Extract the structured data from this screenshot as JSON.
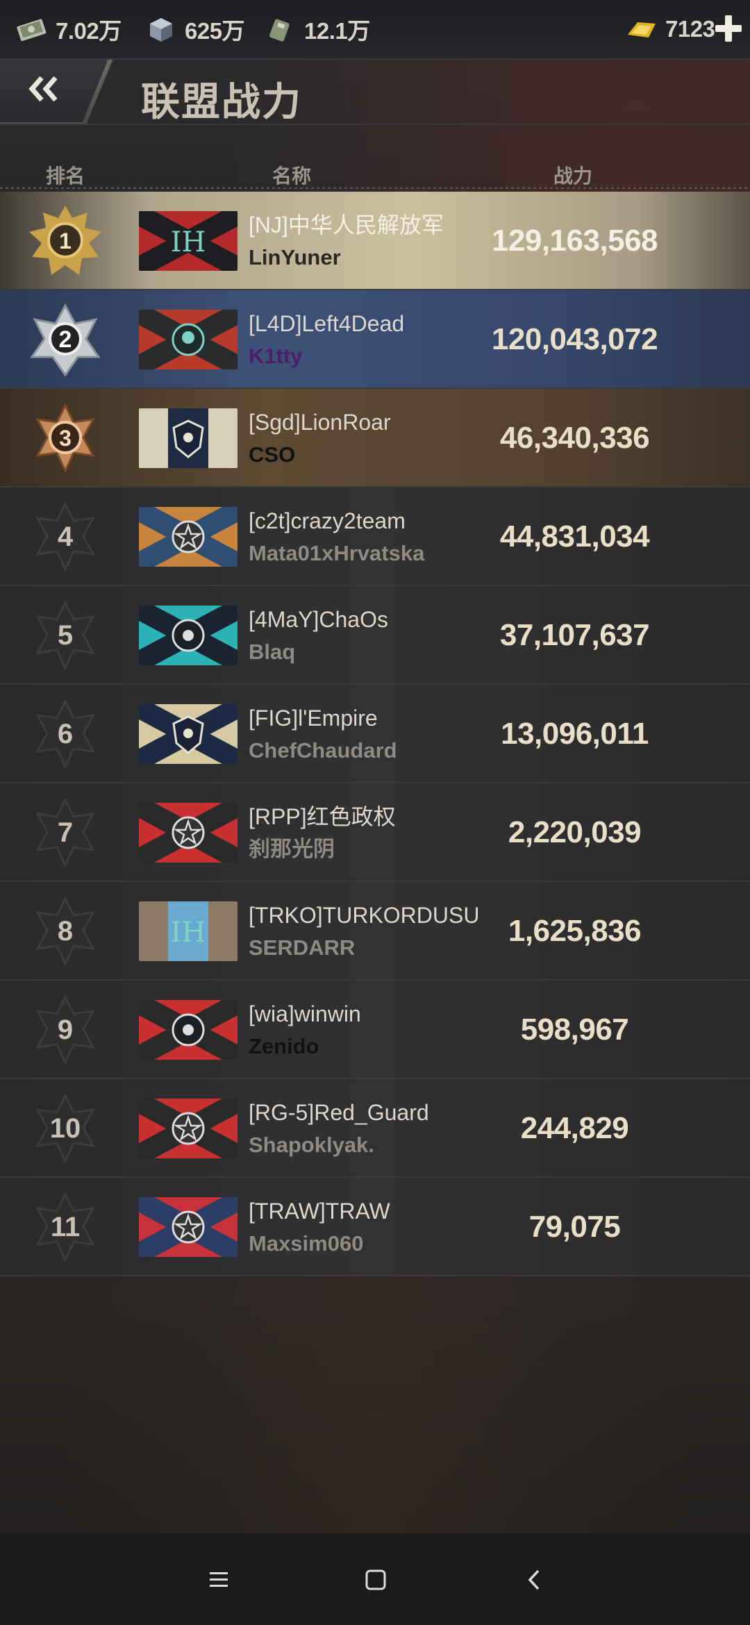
{
  "resources": [
    {
      "icon": "banknote-icon",
      "value": "7.02万"
    },
    {
      "icon": "steel-block-icon",
      "value": "625万"
    },
    {
      "icon": "fuel-can-icon",
      "value": "12.1万"
    }
  ],
  "gold": {
    "icon": "gold-bars-icon",
    "value": "7123"
  },
  "header": {
    "title": "联盟战力",
    "back_icon": "double-chevron-left-icon"
  },
  "columns": {
    "rank": "排名",
    "name": "名称",
    "power": "战力"
  },
  "rows": [
    {
      "rank": "1",
      "clan": "[NJ]中华人民解放军",
      "leader": "LinYuner",
      "power": "129,163,568"
    },
    {
      "rank": "2",
      "clan": "[L4D]Left4Dead",
      "leader": "K1tty",
      "power": "120,043,072"
    },
    {
      "rank": "3",
      "clan": "[Sgd]LionRoar",
      "leader": "CSO",
      "power": "46,340,336"
    },
    {
      "rank": "4",
      "clan": "[c2t]crazy2team",
      "leader": "Mata01xHrvatska",
      "power": "44,831,034"
    },
    {
      "rank": "5",
      "clan": "[4MaY]ChaOs",
      "leader": "Blaq",
      "power": "37,107,637"
    },
    {
      "rank": "6",
      "clan": "[FIG]l'Empire",
      "leader": "ChefChaudard",
      "power": "13,096,011"
    },
    {
      "rank": "7",
      "clan": "[RPP]红色政权",
      "leader": "刹那光阴",
      "power": "2,220,039"
    },
    {
      "rank": "8",
      "clan": "[TRKO]TURKORDUSU",
      "leader": "SERDARR",
      "power": "1,625,836"
    },
    {
      "rank": "9",
      "clan": "[wia]winwin",
      "leader": "Zenido",
      "power": "598,967"
    },
    {
      "rank": "10",
      "clan": "[RG-5]Red_Guard",
      "leader": "Shapoklyak.",
      "power": "244,829"
    },
    {
      "rank": "11",
      "clan": "[TRAW]TRAW",
      "leader": "Maxsim060",
      "power": "79,075"
    }
  ],
  "colors": {
    "gold_row": "#cbbf9f",
    "silver_row": "#3d5177",
    "bronze_row": "#5e4a33",
    "power_text": "#e9dfc8"
  },
  "navbar": [
    "menu-icon",
    "home-square-icon",
    "back-arrow-icon"
  ]
}
